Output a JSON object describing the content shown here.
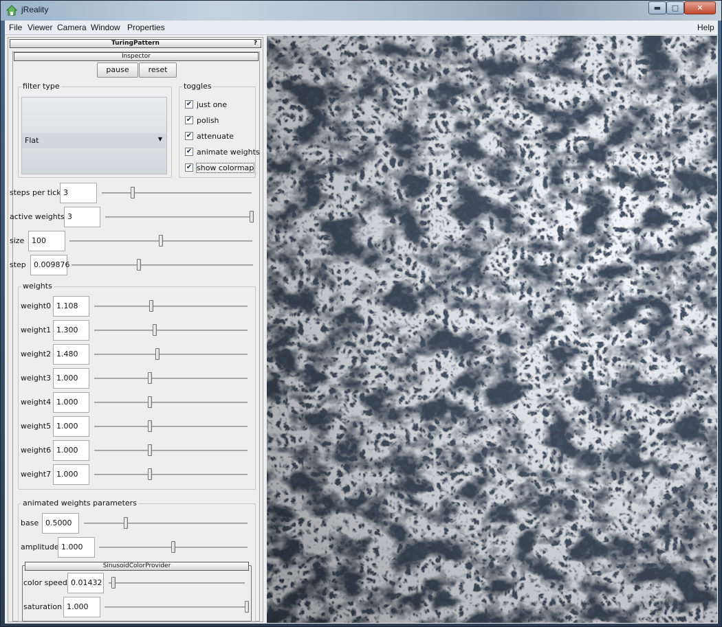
{
  "window": {
    "title": "jReality"
  },
  "menu": {
    "items": [
      "File",
      "Viewer",
      "Camera",
      "Window",
      "Properties"
    ],
    "help": "Help"
  },
  "panel": {
    "title": "TuringPattern",
    "help_label": "?",
    "inspector_title": "Inspector",
    "pause_label": "pause",
    "reset_label": "reset",
    "filter_type": {
      "title": "filter type",
      "selected": "Flat"
    },
    "toggles": {
      "title": "toggles",
      "items": [
        {
          "label": "just one",
          "checked": true
        },
        {
          "label": "polish",
          "checked": true
        },
        {
          "label": "attenuate",
          "checked": true
        },
        {
          "label": "animate weights",
          "checked": true
        },
        {
          "label": "show colormap",
          "checked": true
        }
      ]
    },
    "params": [
      {
        "label": "steps per tick",
        "value": "3",
        "level": 0.2
      },
      {
        "label": "active weights",
        "value": "3",
        "level": 1.0
      },
      {
        "label": "size",
        "value": "100",
        "level": 0.5
      },
      {
        "label": "step",
        "value": "0.009876",
        "level": 0.37
      }
    ],
    "weights": {
      "title": "weights",
      "items": [
        {
          "label": "weight0",
          "value": "1.108",
          "level": 0.37
        },
        {
          "label": "weight1",
          "value": "1.300",
          "level": 0.39
        },
        {
          "label": "weight2",
          "value": "1.480",
          "level": 0.41
        },
        {
          "label": "weight3",
          "value": "1.000",
          "level": 0.36
        },
        {
          "label": "weight4",
          "value": "1.000",
          "level": 0.36
        },
        {
          "label": "weight5",
          "value": "1.000",
          "level": 0.36
        },
        {
          "label": "weight6",
          "value": "1.000",
          "level": 0.36
        },
        {
          "label": "weight7",
          "value": "1.000",
          "level": 0.36
        }
      ]
    },
    "animated": {
      "title": "animated weights parameters",
      "items": [
        {
          "label": "base",
          "value": "0.5000",
          "level": 0.25
        },
        {
          "label": "amplitude",
          "value": "1.000",
          "level": 0.5
        }
      ]
    },
    "sinusoid": {
      "title": "SinusoidColorProvider",
      "items": [
        {
          "label": "color speed",
          "value": "0.01432",
          "level": 0.02
        },
        {
          "label": "saturation",
          "value": "1.000",
          "level": 1.0
        }
      ]
    }
  }
}
